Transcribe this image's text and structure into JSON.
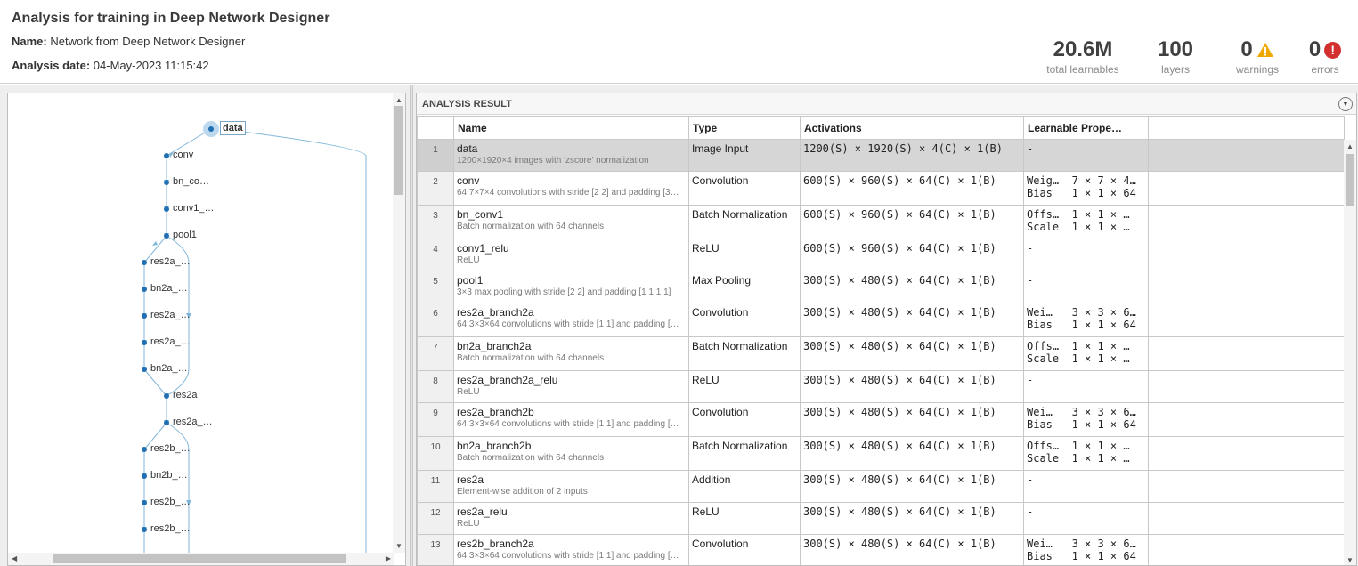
{
  "header": {
    "title": "Analysis for training in Deep Network Designer",
    "name_label": "Name:",
    "name_value": "Network from Deep Network Designer",
    "date_label": "Analysis date:",
    "date_value": "04-May-2023 11:15:42",
    "stats": {
      "learnables": {
        "value": "20.6M",
        "caption": "total learnables"
      },
      "layers": {
        "value": "100",
        "caption": "layers"
      },
      "warnings": {
        "value": "0",
        "caption": "warnings",
        "icon": "warning-triangle-icon",
        "color": "#f0a800"
      },
      "errors": {
        "value": "0",
        "caption": "errors",
        "icon": "error-circle-icon",
        "color": "#d32f2f"
      }
    }
  },
  "graph": {
    "nodes": [
      "data",
      "conv",
      "bn_co…",
      "conv1_…",
      "pool1",
      "res2a_…",
      "bn2a_…",
      "res2a_…",
      "res2a_…",
      "bn2a_…",
      "res2a",
      "res2a_…",
      "res2b_…",
      "bn2b_…",
      "res2b_…",
      "res2b_…"
    ],
    "selected": "data",
    "accent": "#1f77b4",
    "edge_color": "#7fb6d9"
  },
  "result": {
    "title": "ANALYSIS RESULT",
    "columns": {
      "name": "Name",
      "type": "Type",
      "activations": "Activations",
      "learnables": "Learnable Prope…"
    },
    "rows": [
      {
        "idx": "1",
        "name": "data",
        "desc": "1200×1920×4 images with 'zscore' normalization",
        "type": "Image Input",
        "act": "1200(S) × 1920(S) × 4(C) × 1(B)",
        "learn1": "-",
        "learn2": ""
      },
      {
        "idx": "2",
        "name": "conv",
        "desc": "64 7×7×4 convolutions with stride [2 2] and padding [3…",
        "type": "Convolution",
        "act": "600(S) × 960(S) × 64(C) × 1(B)",
        "learn1": "Weig…  7 × 7 × 4…",
        "learn2": "Bias   1 × 1 × 64"
      },
      {
        "idx": "3",
        "name": "bn_conv1",
        "desc": "Batch normalization with 64 channels",
        "type": "Batch Normalization",
        "act": "600(S) × 960(S) × 64(C) × 1(B)",
        "learn1": "Offs…  1 × 1 × …",
        "learn2": "Scale  1 × 1 × …"
      },
      {
        "idx": "4",
        "name": "conv1_relu",
        "desc": "ReLU",
        "type": "ReLU",
        "act": "600(S) × 960(S) × 64(C) × 1(B)",
        "learn1": "-",
        "learn2": ""
      },
      {
        "idx": "5",
        "name": "pool1",
        "desc": "3×3 max pooling with stride [2 2] and padding [1 1 1 1]",
        "type": "Max Pooling",
        "act": "300(S) × 480(S) × 64(C) × 1(B)",
        "learn1": "-",
        "learn2": ""
      },
      {
        "idx": "6",
        "name": "res2a_branch2a",
        "desc": "64 3×3×64 convolutions with stride [1 1] and padding […",
        "type": "Convolution",
        "act": "300(S) × 480(S) × 64(C) × 1(B)",
        "learn1": "Wei…   3 × 3 × 6…",
        "learn2": "Bias   1 × 1 × 64"
      },
      {
        "idx": "7",
        "name": "bn2a_branch2a",
        "desc": "Batch normalization with 64 channels",
        "type": "Batch Normalization",
        "act": "300(S) × 480(S) × 64(C) × 1(B)",
        "learn1": "Offs…  1 × 1 × …",
        "learn2": "Scale  1 × 1 × …"
      },
      {
        "idx": "8",
        "name": "res2a_branch2a_relu",
        "desc": "ReLU",
        "type": "ReLU",
        "act": "300(S) × 480(S) × 64(C) × 1(B)",
        "learn1": "-",
        "learn2": ""
      },
      {
        "idx": "9",
        "name": "res2a_branch2b",
        "desc": "64 3×3×64 convolutions with stride [1 1] and padding […",
        "type": "Convolution",
        "act": "300(S) × 480(S) × 64(C) × 1(B)",
        "learn1": "Wei…   3 × 3 × 6…",
        "learn2": "Bias   1 × 1 × 64"
      },
      {
        "idx": "10",
        "name": "bn2a_branch2b",
        "desc": "Batch normalization with 64 channels",
        "type": "Batch Normalization",
        "act": "300(S) × 480(S) × 64(C) × 1(B)",
        "learn1": "Offs…  1 × 1 × …",
        "learn2": "Scale  1 × 1 × …"
      },
      {
        "idx": "11",
        "name": "res2a",
        "desc": "Element-wise addition of 2 inputs",
        "type": "Addition",
        "act": "300(S) × 480(S) × 64(C) × 1(B)",
        "learn1": "-",
        "learn2": ""
      },
      {
        "idx": "12",
        "name": "res2a_relu",
        "desc": "ReLU",
        "type": "ReLU",
        "act": "300(S) × 480(S) × 64(C) × 1(B)",
        "learn1": "-",
        "learn2": ""
      },
      {
        "idx": "13",
        "name": "res2b_branch2a",
        "desc": "64 3×3×64 convolutions with stride [1 1] and padding […",
        "type": "Convolution",
        "act": "300(S) × 480(S) × 64(C) × 1(B)",
        "learn1": "Wei…   3 × 3 × 6…",
        "learn2": "Bias   1 × 1 × 64"
      }
    ]
  }
}
